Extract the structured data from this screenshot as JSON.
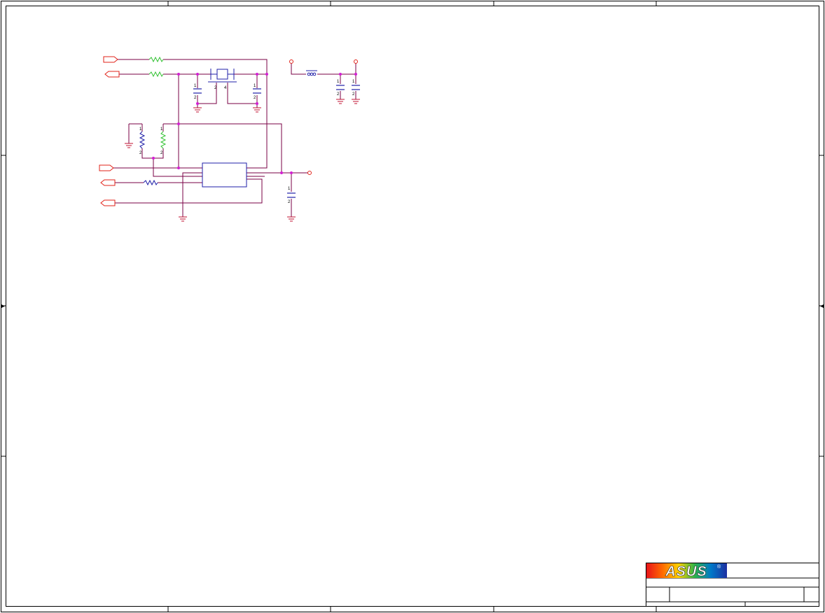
{
  "logo": {
    "text": "ASUS",
    "registered": "®",
    "gradient": [
      "#e8141a",
      "#ff6a00",
      "#ffd200",
      "#2bb34a",
      "#0078c8",
      "#1d2fa0"
    ]
  },
  "colors": {
    "frame": "#000000",
    "wire": "#7a0045",
    "port": "#e2231a",
    "junction": "#d21ed2",
    "ground": "#c01030",
    "resistor_green": "#34c234",
    "resistor_blue": "#1f1fa8",
    "cap": "#1f1fa8",
    "ic": "#1f1fa8",
    "ferrite": "#1f1fa8",
    "power": "#e2231a"
  },
  "pin_labels": {
    "c1_top": "1",
    "c1_bot": "2",
    "c2_top": "1",
    "c2_bot": "2",
    "xtal_a": "2",
    "xtal_b": "4",
    "c3_top": "1",
    "c3_bot": "2",
    "c4_top": "1",
    "c4_bot": "2",
    "r3_top": "1",
    "r3_bot": "2",
    "r4_top": "1",
    "r4_bot": "2",
    "c5_top": "1",
    "c5_bot": "2"
  }
}
